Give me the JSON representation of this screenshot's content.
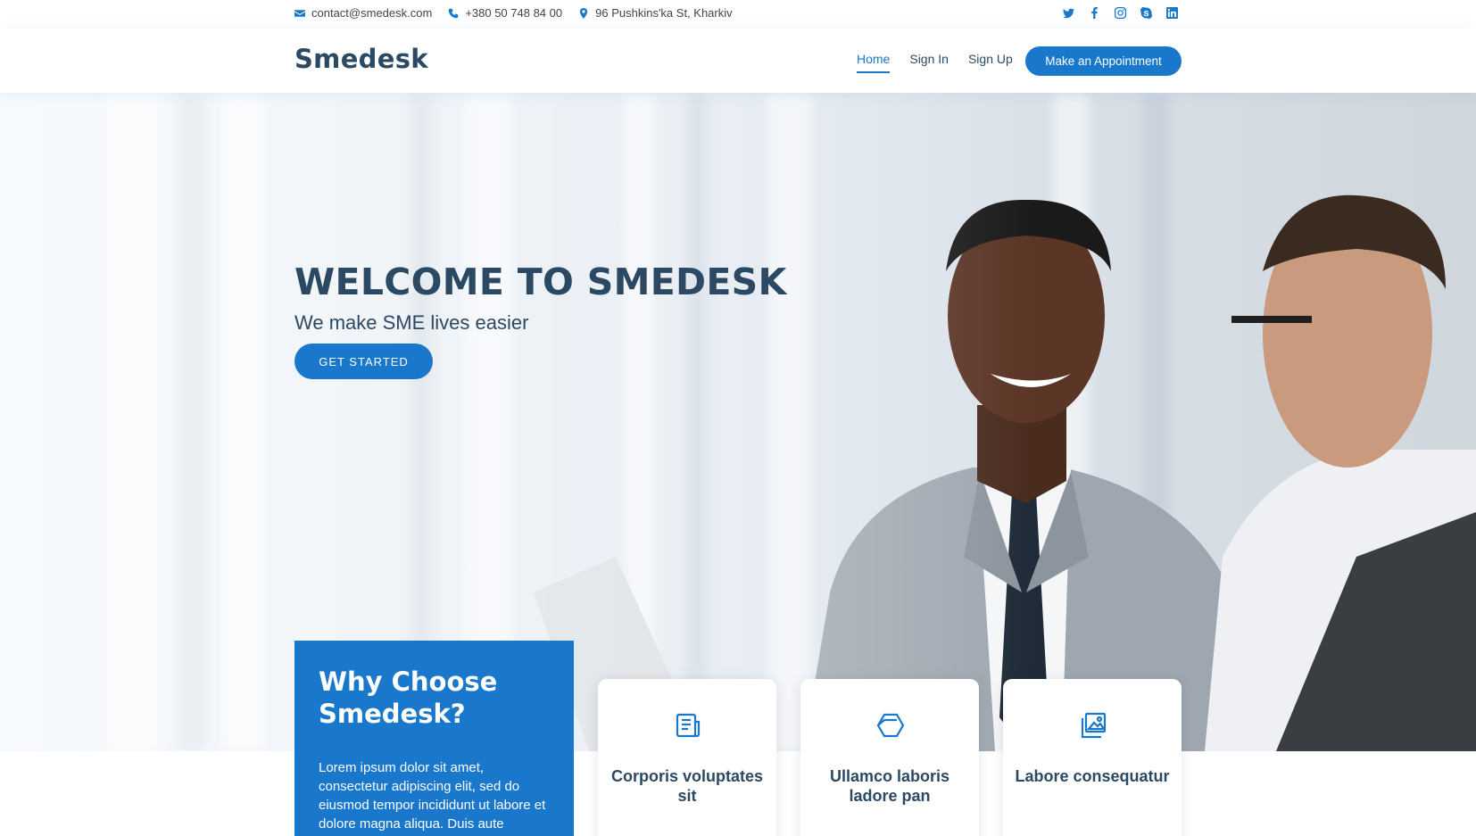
{
  "topbar": {
    "email": "contact@smedesk.com",
    "phone": "+380 50 748 84 00",
    "address": "96 Pushkins'ka St, Kharkiv",
    "social_icons": [
      "twitter-icon",
      "facebook-icon",
      "instagram-icon",
      "skype-icon",
      "linkedin-icon"
    ]
  },
  "header": {
    "logo": "Smedesk",
    "nav": [
      {
        "label": "Home",
        "active": true
      },
      {
        "label": "Sign In",
        "active": false
      },
      {
        "label": "Sign Up",
        "active": false
      }
    ],
    "appointment_button": "Make an Appointment"
  },
  "hero": {
    "title": "WELCOME TO SMEDESK",
    "subtitle": "We make SME lives easier",
    "cta": "GET STARTED"
  },
  "why": {
    "title": "Why Choose Smedesk?",
    "text": "Lorem ipsum dolor sit amet, consectetur adipiscing elit, sed do eiusmod tempor incididunt ut labore et dolore magna aliqua. Duis aute"
  },
  "features": [
    {
      "icon": "document-icon",
      "title": "Corporis voluptates sit"
    },
    {
      "icon": "cube-icon",
      "title": "Ullamco laboris ladore pan"
    },
    {
      "icon": "images-icon",
      "title": "Labore consequatur"
    }
  ],
  "colors": {
    "accent": "#1977cc",
    "heading": "#2c4964"
  }
}
